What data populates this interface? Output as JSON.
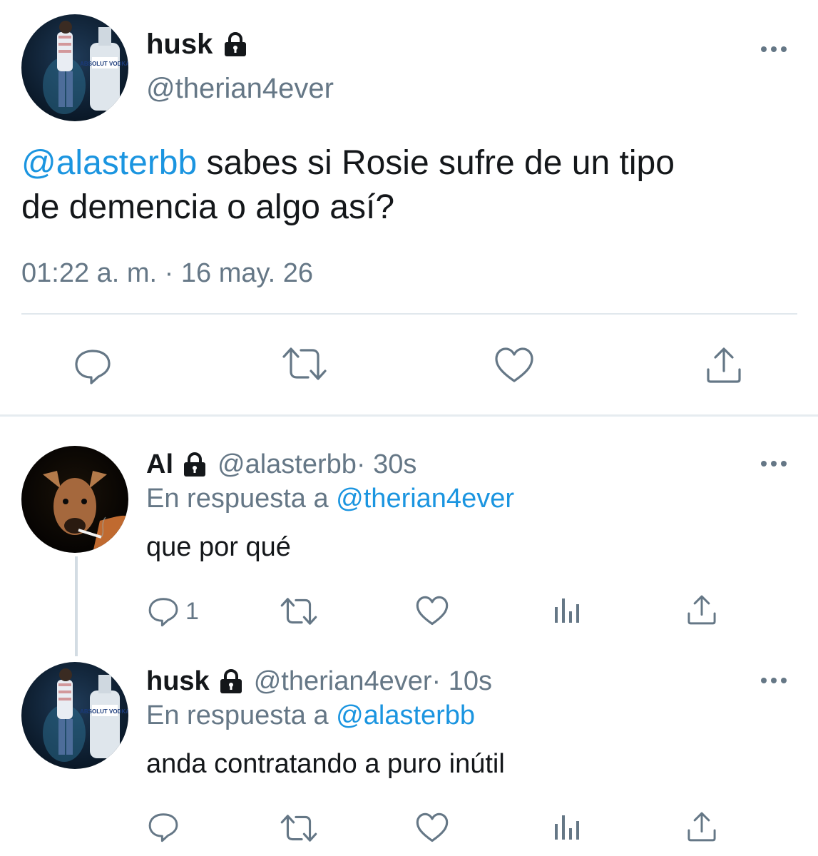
{
  "main_tweet": {
    "display_name": "husk",
    "handle": "@therian4ever",
    "mention": "@alasterbb",
    "text_line1": " sabes si Rosie sufre de un tipo",
    "text_line2": "de demencia o algo así?",
    "timestamp": "01:22 a. m. · 16 may. 26"
  },
  "replies": [
    {
      "display_name": "Al",
      "handle": "@alasterbb",
      "time": " · 30s",
      "reply_prefix": "En respuesta a ",
      "reply_to": "@therian4ever",
      "text": "que por qué",
      "reply_count": "1"
    },
    {
      "display_name": "husk",
      "handle": "@therian4ever",
      "time": " · 10s",
      "reply_prefix": "En respuesta a ",
      "reply_to": "@alasterbb",
      "text": "anda contratando a puro inútil",
      "reply_count": ""
    }
  ],
  "icons": [
    "lock-icon",
    "more-icon",
    "reply-icon",
    "retweet-icon",
    "like-icon",
    "analytics-icon",
    "share-icon"
  ],
  "colors": {
    "link": "#1b95e0",
    "secondary": "#657786",
    "divider": "#e1e8ed"
  },
  "avatars": {
    "husk_bottle_label": "ABSOLUT VODKA"
  }
}
